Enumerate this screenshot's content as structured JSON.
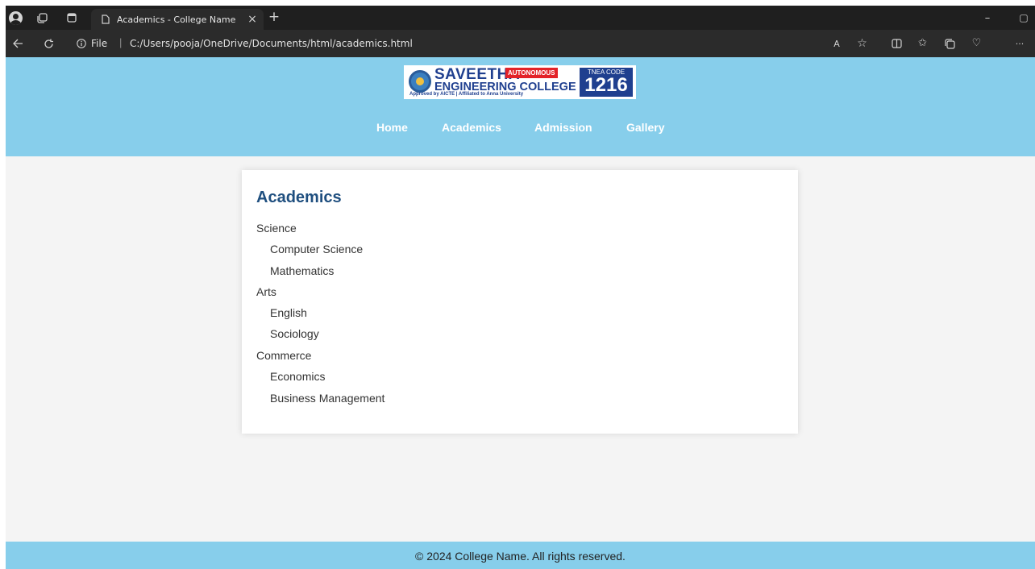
{
  "browser": {
    "tab_title": "Academics - College Name",
    "tab_close": "×",
    "new_tab": "+",
    "address_label": "File",
    "address_url": "C:/Users/pooja/OneDrive/Documents/html/academics.html",
    "minimize": "–",
    "restore": "▢",
    "more": "···"
  },
  "logo": {
    "name": "SAVEETHA",
    "badge": "AUTONOMOUS",
    "subtitle": "ENGINEERING COLLEGE",
    "tagline": "Approved by AICTE | Affiliated to Anna University",
    "code_label": "TNEA CODE",
    "code": "1216"
  },
  "nav": {
    "items": [
      "Home",
      "Academics",
      "Admission",
      "Gallery"
    ]
  },
  "content": {
    "title": "Academics",
    "sections": [
      {
        "name": "Science",
        "items": [
          "Computer Science",
          "Mathematics"
        ]
      },
      {
        "name": "Arts",
        "items": [
          "English",
          "Sociology"
        ]
      },
      {
        "name": "Commerce",
        "items": [
          "Economics",
          "Business Management"
        ]
      }
    ]
  },
  "footer": {
    "text": "© 2024 College Name. All rights reserved."
  },
  "colors": {
    "header_bg": "#87ceeb",
    "page_bg": "#f4f4f4",
    "title": "#1f4f7f"
  }
}
